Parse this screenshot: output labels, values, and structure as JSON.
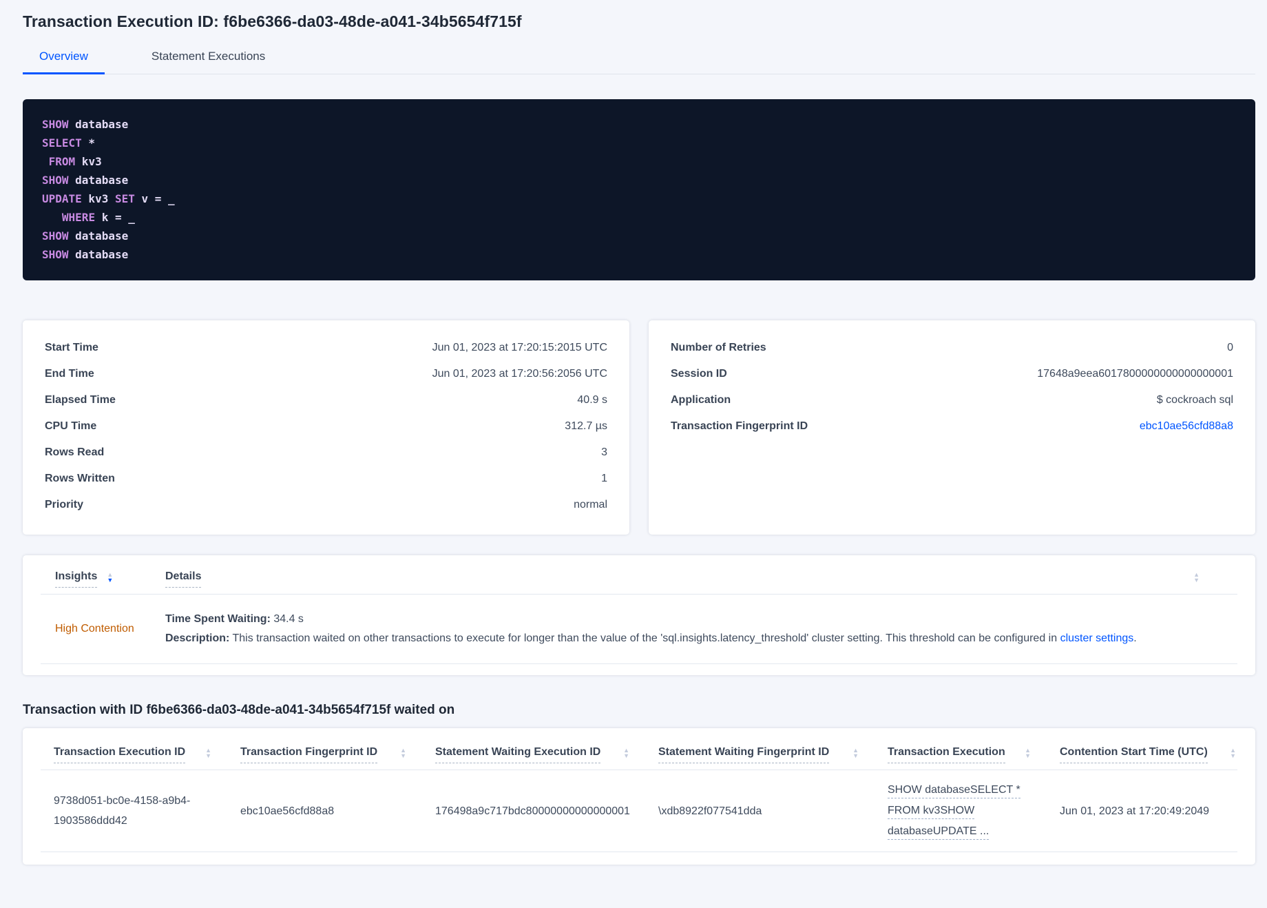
{
  "page": {
    "title": "Transaction Execution ID: f6be6366-da03-48de-a041-34b5654f715f"
  },
  "tabs": [
    {
      "label": "Overview",
      "active": true
    },
    {
      "label": "Statement Executions",
      "active": false
    }
  ],
  "colors": {
    "accent_blue": "#0055ff",
    "insight_orange": "#c05c00",
    "sql_keyword": "#c88ae2",
    "sql_identifier": "#e4dcf6",
    "code_background": "#0d1628"
  },
  "sql": {
    "lines": [
      [
        {
          "t": "SHOW",
          "k": true
        },
        {
          "t": " database",
          "k": false
        }
      ],
      [
        {
          "t": "SELECT",
          "k": true
        },
        {
          "t": " *",
          "k": false
        }
      ],
      [
        {
          "t": " ",
          "k": false
        },
        {
          "t": "FROM",
          "k": true
        },
        {
          "t": " kv3",
          "k": false
        }
      ],
      [
        {
          "t": "SHOW",
          "k": true
        },
        {
          "t": " database",
          "k": false
        }
      ],
      [
        {
          "t": "UPDATE",
          "k": true
        },
        {
          "t": " kv3 ",
          "k": false
        },
        {
          "t": "SET",
          "k": true
        },
        {
          "t": " v = _",
          "k": false
        }
      ],
      [
        {
          "t": "   ",
          "k": false
        },
        {
          "t": "WHERE",
          "k": true
        },
        {
          "t": " k = _",
          "k": false
        }
      ],
      [
        {
          "t": "SHOW",
          "k": true
        },
        {
          "t": " database",
          "k": false
        }
      ],
      [
        {
          "t": "SHOW",
          "k": true
        },
        {
          "t": " database",
          "k": false
        }
      ]
    ]
  },
  "summary_left": {
    "rows": [
      {
        "label": "Start Time",
        "value": "Jun 01, 2023 at 17:20:15:2015 UTC"
      },
      {
        "label": "End Time",
        "value": "Jun 01, 2023 at 17:20:56:2056 UTC"
      },
      {
        "label": "Elapsed Time",
        "value": "40.9 s"
      },
      {
        "label": "CPU Time",
        "value": "312.7 µs"
      },
      {
        "label": "Rows Read",
        "value": "3"
      },
      {
        "label": "Rows Written",
        "value": "1"
      },
      {
        "label": "Priority",
        "value": "normal"
      }
    ]
  },
  "summary_right": {
    "rows": [
      {
        "label": "Number of Retries",
        "value": "0"
      },
      {
        "label": "Session ID",
        "value": "17648a9eea6017800000000000000001"
      },
      {
        "label": "Application",
        "value": "$ cockroach sql"
      },
      {
        "label": "Transaction Fingerprint ID",
        "value": "ebc10ae56cfd88a8",
        "link": true
      }
    ]
  },
  "insights_table": {
    "insights_column": "Insights",
    "details_column": "Details",
    "row": {
      "insight": "High Contention",
      "waiting_label": "Time Spent Waiting:",
      "waiting_value": " 34.4 s",
      "description_label": "Description:",
      "description_text": " This transaction waited on other transactions to execute for longer than the value of the 'sql.insights.latency_threshold' cluster setting. This threshold can be configured in ",
      "description_link": "cluster settings",
      "description_suffix": "."
    }
  },
  "waited_on": {
    "heading": "Transaction with ID f6be6366-da03-48de-a041-34b5654f715f waited on",
    "columns": [
      "Transaction Execution ID",
      "Transaction Fingerprint ID",
      "Statement Waiting Execution ID",
      "Statement Waiting Fingerprint ID",
      "Transaction Execution",
      "Contention Start Time (UTC)"
    ],
    "row": {
      "transaction_execution_id": "9738d051-bc0e-4158-a9b4-1903586ddd42",
      "transaction_fingerprint_id": "ebc10ae56cfd88a8",
      "statement_waiting_execution_id": "176498a9c717bdc80000000000000001",
      "statement_waiting_fingerprint_id": "\\xdb8922f077541dda",
      "transaction_execution_lines": [
        "SHOW databaseSELECT *",
        "FROM kv3SHOW",
        "databaseUPDATE ..."
      ],
      "contention_start_time": "Jun 01, 2023 at 17:20:49:2049"
    }
  }
}
